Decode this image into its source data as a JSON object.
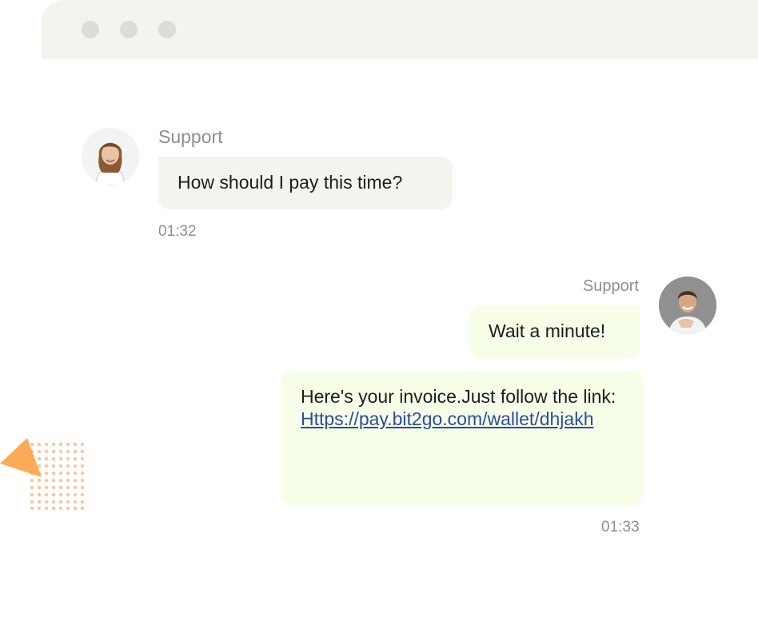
{
  "window": {
    "controls": [
      "dot-1",
      "dot-2",
      "dot-3"
    ]
  },
  "messages": [
    {
      "sender": "Support",
      "text": "How should I pay this time?",
      "time": "01:32",
      "side": "left"
    },
    {
      "sender": "Support",
      "text": "Wait a minute!",
      "side": "right"
    },
    {
      "text": "Here's your invoice.Just follow the link:",
      "link": "Https://pay.bit2go.com/wallet/dhjakh",
      "time": "01:33",
      "side": "right"
    }
  ],
  "colors": {
    "window_bar": "#f4f3ee",
    "incoming_bubble": "#f4f3ee",
    "outgoing_bubble": "#f6fee8",
    "link": "#2e4c9b",
    "muted_text": "#8e8e8e",
    "accent_orange": "#fba64f"
  }
}
